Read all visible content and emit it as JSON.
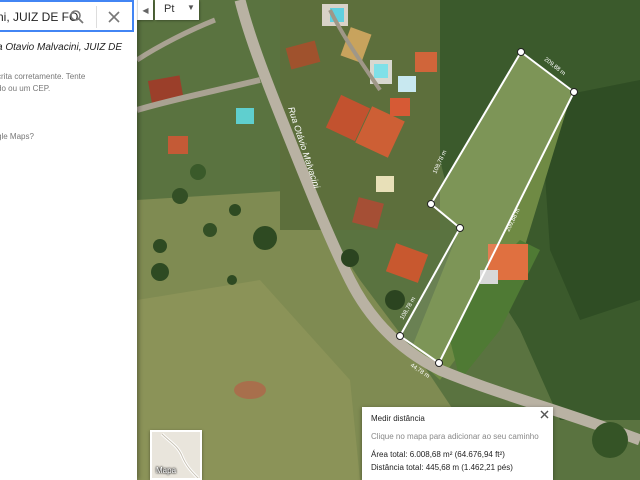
{
  "search": {
    "value": "ni, JUIZ DE FO",
    "search_icon": "search-icon",
    "close_icon": "close-icon"
  },
  "result": {
    "address": "a Otavio Malvacini, JUIZ DE",
    "messages": [
      "crita corretamente. Tente",
      "do ou um CEP.",
      "gle Maps?"
    ]
  },
  "toolbar": {
    "collapse_icon": "chevron-left-icon",
    "language": "Pt",
    "language_icon": "caret-down-icon"
  },
  "map": {
    "street_name": "Rua Otávio Malvacini",
    "segment_labels": [
      "209,88 m",
      "108,78 m",
      "209,88 m",
      "108,78 m",
      "44,78 m"
    ],
    "map_type_label": "Mapa"
  },
  "measure": {
    "title": "Medir distância",
    "hint": "Clique no mapa para adicionar ao seu caminho",
    "area": "Área total: 6.008,68 m² (64.676,94 ft²)",
    "distance": "Distância total: 445,68 m (1.462,21 pés)",
    "close_icon": "close-icon"
  },
  "colors": {
    "accent": "#4285f4",
    "measure_line": "#ffffff"
  }
}
